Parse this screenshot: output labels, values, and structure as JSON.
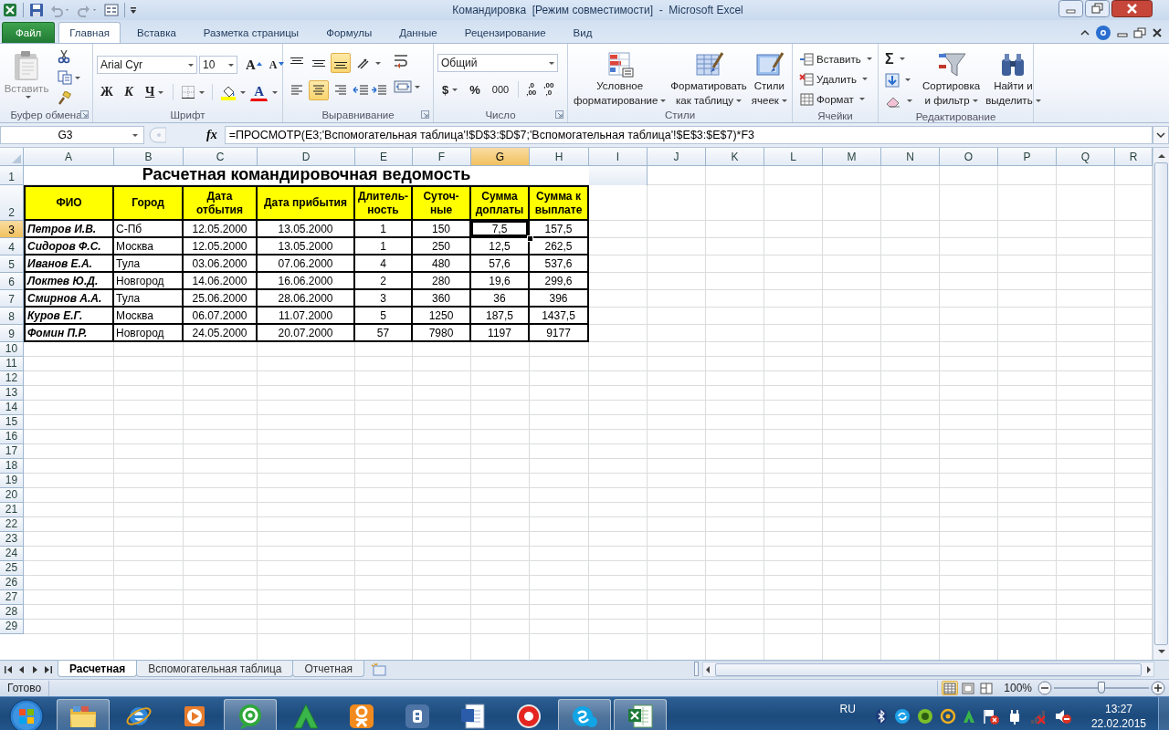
{
  "window": {
    "title": "Командировка  [Режим совместимости]  -  Microsoft Excel"
  },
  "ribbon_tabs": [
    {
      "label": "Файл",
      "kind": "file",
      "selected": false
    },
    {
      "label": "Главная",
      "kind": "tab",
      "selected": true
    },
    {
      "label": "Вставка",
      "kind": "tab",
      "selected": false
    },
    {
      "label": "Разметка страницы",
      "kind": "tab",
      "selected": false
    },
    {
      "label": "Формулы",
      "kind": "tab",
      "selected": false
    },
    {
      "label": "Данные",
      "kind": "tab",
      "selected": false
    },
    {
      "label": "Рецензирование",
      "kind": "tab",
      "selected": false
    },
    {
      "label": "Вид",
      "kind": "tab",
      "selected": false
    }
  ],
  "ribbon": {
    "clipboard": {
      "paste": {
        "label": "Вставить",
        "disabled": true
      },
      "label": "Буфер обмена"
    },
    "font": {
      "name": "Arial Cyr",
      "size": "10",
      "grow": "A",
      "shrink": "A",
      "bold": "Ж",
      "italic": "К",
      "underline": "Ч",
      "color_letter": "A",
      "label": "Шрифт"
    },
    "alignment": {
      "vertical": [
        {
          "selected": false
        },
        {
          "selected": false
        },
        {
          "selected": true
        }
      ],
      "horizontal": [
        {
          "selected": false
        },
        {
          "selected": true
        },
        {
          "selected": false
        }
      ],
      "label": "Выравнивание"
    },
    "number": {
      "format": "Общий",
      "currency": "$",
      "percent": "%",
      "thousands": "000",
      "increase_decimal": [
        ",0",
        ",00"
      ],
      "decrease_decimal": [
        ",00",
        ",0"
      ],
      "label": "Число"
    },
    "styles": {
      "buttons": [
        {
          "kind": "conditional",
          "lines": [
            "Условное",
            "форматирование"
          ]
        },
        {
          "kind": "table",
          "lines": [
            "Форматировать",
            "как таблицу"
          ]
        },
        {
          "kind": "cell",
          "lines": [
            "Стили",
            "ячеек"
          ]
        }
      ],
      "label": "Стили"
    },
    "cells": {
      "buttons": [
        {
          "kind": "insert",
          "label": "Вставить"
        },
        {
          "kind": "delete",
          "label": "Удалить"
        },
        {
          "kind": "format",
          "label": "Формат"
        }
      ],
      "label": "Ячейки"
    },
    "editing": {
      "sum": "Σ",
      "buttons": [
        {
          "kind": "sort",
          "lines": [
            "Сортировка",
            "и фильтр"
          ]
        },
        {
          "kind": "find",
          "lines": [
            "Найти и",
            "выделить"
          ]
        }
      ],
      "label": "Редактирование"
    }
  },
  "formula_bar": {
    "name_box": "G3",
    "fx": "fx",
    "formula": "=ПРОСМОТР(E3;'Вспомогательная таблица'!$D$3:$D$7;'Вспомогательная таблица'!$E$3:$E$7)*F3"
  },
  "sheet": {
    "columns": [
      {
        "label": "A",
        "selected": false
      },
      {
        "label": "B",
        "selected": false
      },
      {
        "label": "C",
        "selected": false
      },
      {
        "label": "D",
        "selected": false
      },
      {
        "label": "E",
        "selected": false
      },
      {
        "label": "F",
        "selected": false
      },
      {
        "label": "G",
        "selected": true
      },
      {
        "label": "H",
        "selected": false
      },
      {
        "label": "I",
        "selected": false
      },
      {
        "label": "J",
        "selected": false
      },
      {
        "label": "K",
        "selected": false
      },
      {
        "label": "L",
        "selected": false
      },
      {
        "label": "M",
        "selected": false
      },
      {
        "label": "N",
        "selected": false
      },
      {
        "label": "O",
        "selected": false
      },
      {
        "label": "P",
        "selected": false
      },
      {
        "label": "Q",
        "selected": false
      },
      {
        "label": "R",
        "selected": false
      }
    ],
    "row_numbers": [
      {
        "label": "1",
        "selected": false
      },
      {
        "label": "2",
        "selected": false
      },
      {
        "label": "3",
        "selected": true
      },
      {
        "label": "4",
        "selected": false
      },
      {
        "label": "5",
        "selected": false
      },
      {
        "label": "6",
        "selected": false
      },
      {
        "label": "7",
        "selected": false
      },
      {
        "label": "8",
        "selected": false
      },
      {
        "label": "9",
        "selected": false
      },
      {
        "label": "10",
        "selected": false
      },
      {
        "label": "11",
        "selected": false
      },
      {
        "label": "12",
        "selected": false
      },
      {
        "label": "13",
        "selected": false
      },
      {
        "label": "14",
        "selected": false
      },
      {
        "label": "15",
        "selected": false
      },
      {
        "label": "16",
        "selected": false
      },
      {
        "label": "17",
        "selected": false
      },
      {
        "label": "18",
        "selected": false
      },
      {
        "label": "19",
        "selected": false
      },
      {
        "label": "20",
        "selected": false
      },
      {
        "label": "21",
        "selected": false
      },
      {
        "label": "22",
        "selected": false
      },
      {
        "label": "23",
        "selected": false
      },
      {
        "label": "24",
        "selected": false
      },
      {
        "label": "25",
        "selected": false
      },
      {
        "label": "26",
        "selected": false
      },
      {
        "label": "27",
        "selected": false
      },
      {
        "label": "28",
        "selected": false
      },
      {
        "label": "29",
        "selected": false
      }
    ],
    "title": "Расчетная командировочная ведомость",
    "header": [
      [
        "ФИО"
      ],
      [
        "Город"
      ],
      [
        "Дата",
        "отбытия"
      ],
      [
        "Дата прибытия"
      ],
      [
        "Длитель-",
        "ность"
      ],
      [
        "Суточ-",
        "ные"
      ],
      [
        "Сумма",
        "доплаты"
      ],
      [
        "Сумма к",
        "выплате"
      ]
    ],
    "rows": [
      [
        "Петров И.В.",
        "С-Пб",
        "12.05.2000",
        "13.05.2000",
        "1",
        "150",
        "7,5",
        "157,5"
      ],
      [
        "Сидоров Ф.С.",
        "Москва",
        "12.05.2000",
        "13.05.2000",
        "1",
        "250",
        "12,5",
        "262,5"
      ],
      [
        "Иванов Е.А.",
        "Тула",
        "03.06.2000",
        "07.06.2000",
        "4",
        "480",
        "57,6",
        "537,6"
      ],
      [
        "Локтев Ю.Д.",
        "Новгород",
        "14.06.2000",
        "16.06.2000",
        "2",
        "280",
        "19,6",
        "299,6"
      ],
      [
        "Смирнов А.А.",
        "Тула",
        "25.06.2000",
        "28.06.2000",
        "3",
        "360",
        "36",
        "396"
      ],
      [
        "Куров Е.Г.",
        "Москва",
        "06.07.2000",
        "11.07.2000",
        "5",
        "1250",
        "187,5",
        "1437,5"
      ],
      [
        "Фомин П.Р.",
        "Новгород",
        "24.05.2000",
        "20.07.2000",
        "57",
        "7980",
        "1197",
        "9177"
      ]
    ]
  },
  "sheet_tabs": [
    {
      "label": "Расчетная",
      "selected": true
    },
    {
      "label": "Вспомогательная таблица",
      "selected": false
    },
    {
      "label": "Отчетная",
      "selected": false
    }
  ],
  "status_bar": {
    "status": "Готово",
    "views": [
      {
        "selected": true
      },
      {
        "selected": false
      },
      {
        "selected": false
      }
    ],
    "zoom": "100%",
    "zoom_slider": {
      "level": 0.5
    }
  },
  "taskbar": {
    "apps": [
      {
        "kind": "folder",
        "open": true
      },
      {
        "kind": "browser",
        "open": false
      },
      {
        "kind": "player",
        "open": false
      },
      {
        "kind": "mail",
        "open": true
      },
      {
        "kind": "triangle",
        "open": false
      },
      {
        "kind": "person",
        "open": false
      },
      {
        "kind": "tile",
        "open": false
      },
      {
        "kind": "document",
        "open": false
      },
      {
        "kind": "ring",
        "open": false
      },
      {
        "kind": "cloud",
        "open": true
      },
      {
        "kind": "spreadsheet",
        "open": true
      }
    ],
    "language": "RU",
    "time": "13:27",
    "date": "22.02.2015"
  }
}
